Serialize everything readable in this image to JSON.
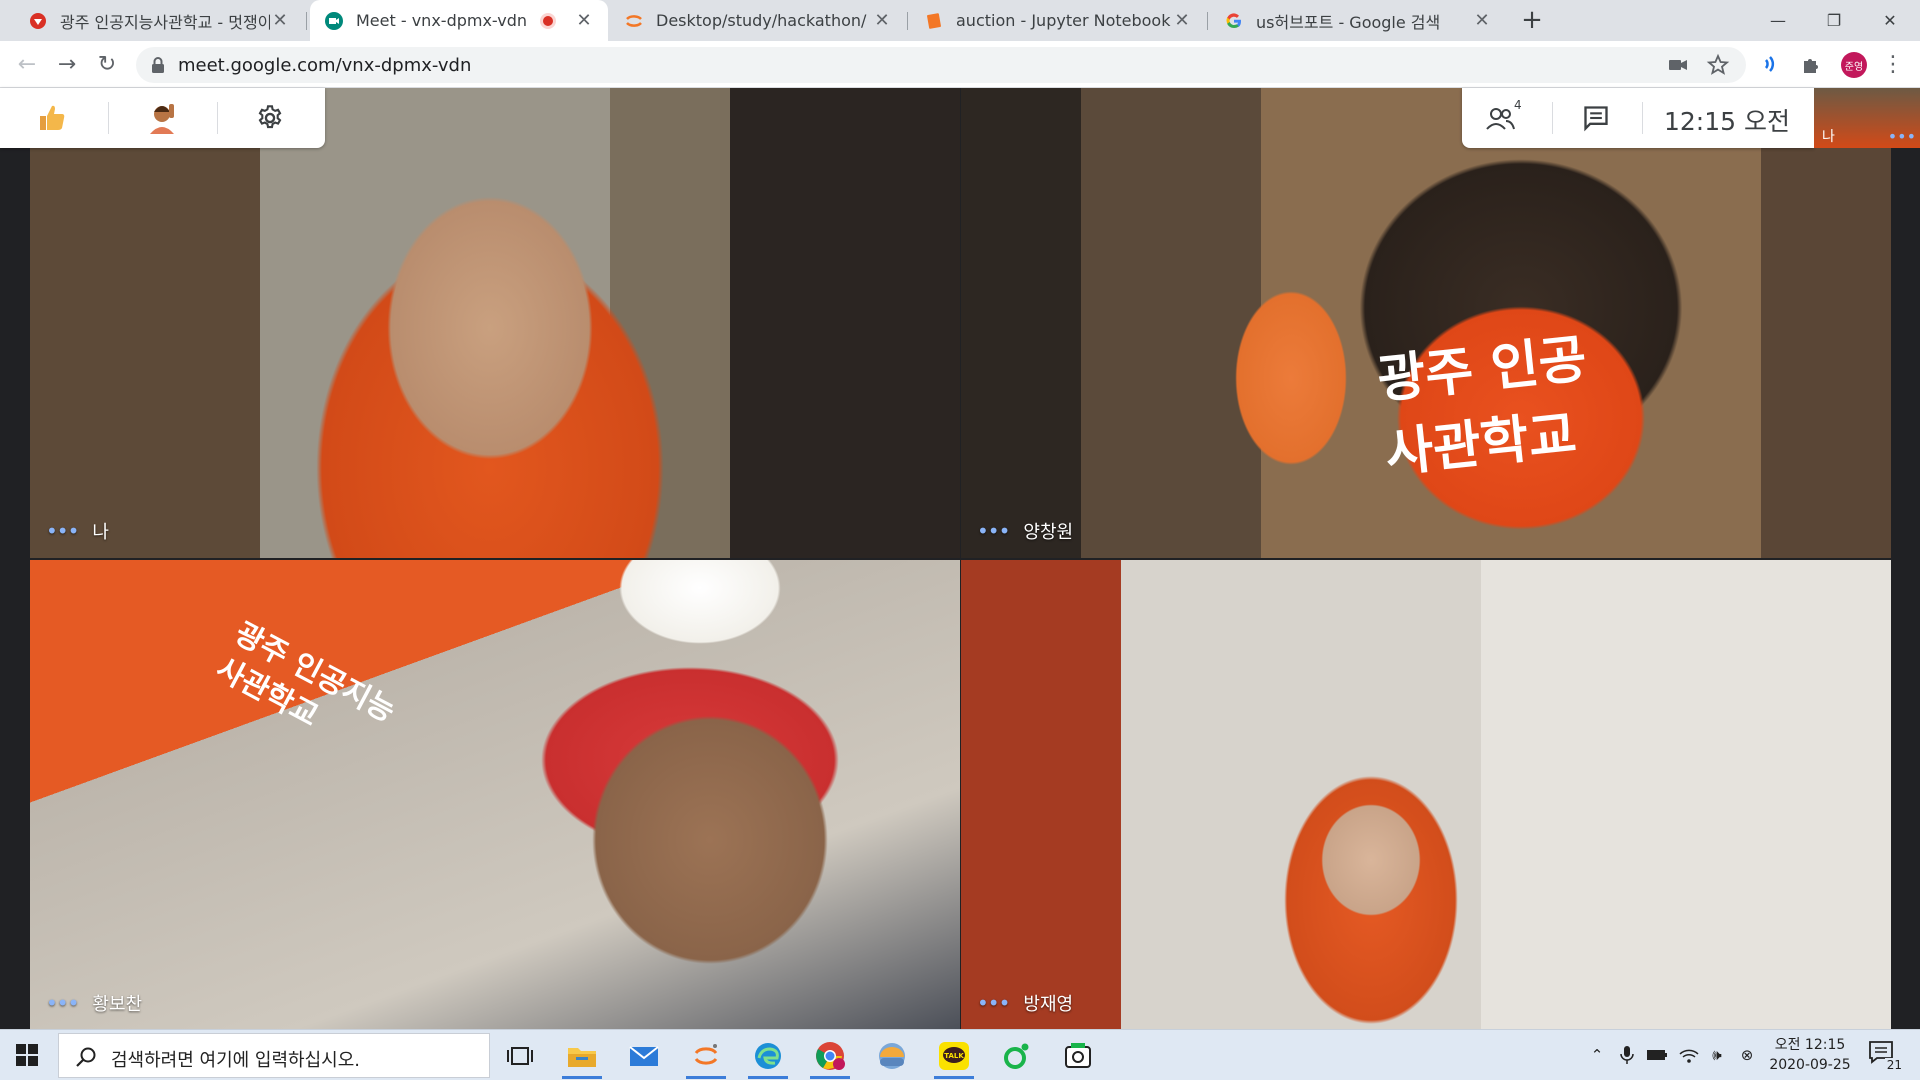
{
  "browser": {
    "tabs": [
      {
        "title": "광주 인공지능사관학교 - 멋쟁이",
        "active": false
      },
      {
        "title": "Meet - vnx-dpmx-vdn",
        "active": true,
        "recording": true
      },
      {
        "title": "Desktop/study/hackathon/",
        "active": false
      },
      {
        "title": "auction - Jupyter Notebook",
        "active": false
      },
      {
        "title": "us허브포트 - Google 검색",
        "active": false
      }
    ],
    "new_tab": "+",
    "url": "meet.google.com/vnx-dpmx-vdn",
    "profile_initials": "준영"
  },
  "meet": {
    "participant_count": "4",
    "clock": "12:15  오전",
    "self_label": "나",
    "tiles": [
      {
        "name": "나"
      },
      {
        "name": "양창원",
        "banner": "광주 인공\n사관학교"
      },
      {
        "name": "황보찬",
        "banner": "광주 인공지능\n사관학교"
      },
      {
        "name": "방재영"
      }
    ]
  },
  "taskbar": {
    "search_placeholder": "검색하려면 여기에 입력하십시오.",
    "time": "오전 12:15",
    "date": "2020-09-25",
    "notification_count": "21"
  },
  "colors": {
    "accent": "#1a73e8",
    "meet_bg": "#202124",
    "record": "#d93025"
  }
}
